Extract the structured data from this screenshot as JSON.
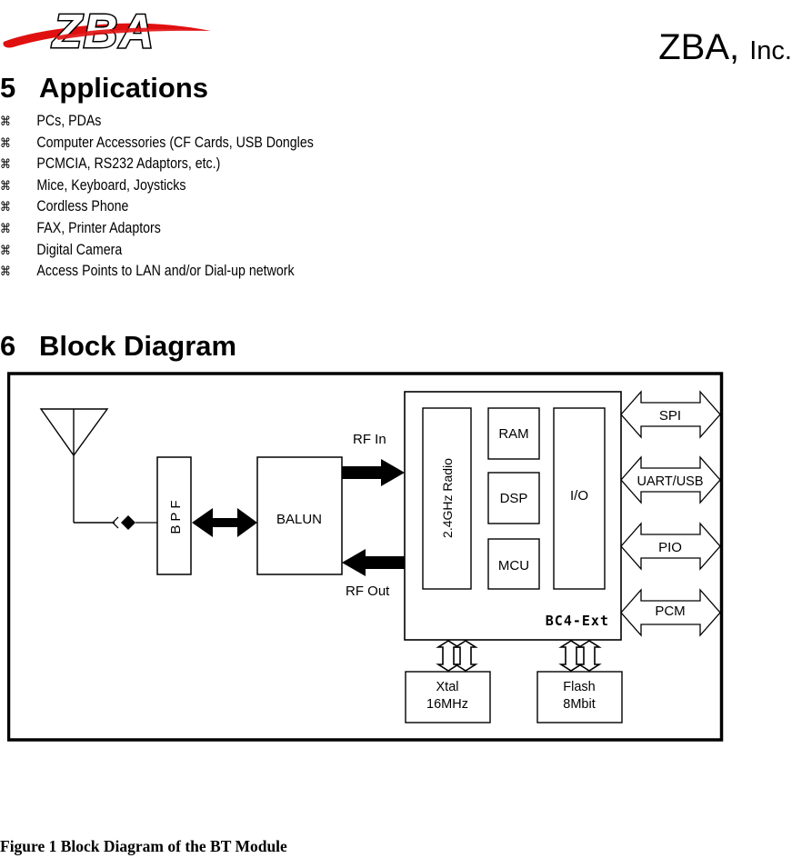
{
  "header": {
    "logo_text": "ZBA",
    "logo_colors": {
      "swoosh": "#e01010",
      "letter_fill": "#ffffff",
      "letter_outline": "#000000"
    },
    "company_name": "ZBA,",
    "company_suffix": "Inc."
  },
  "sections": {
    "applications": {
      "number": "5",
      "title": "Applications",
      "bullet_glyph": "⌘",
      "items": [
        "PCs, PDAs",
        "Computer Accessories (CF Cards, USB Dongles",
        "PCMCIA, RS232 Adaptors, etc.)",
        "Mice, Keyboard, Joysticks",
        "Cordless Phone",
        "FAX, Printer Adaptors",
        "Digital Camera",
        "Access Points to LAN and/or Dial-up network"
      ]
    },
    "block_diagram": {
      "number": "6",
      "title": "Block Diagram"
    }
  },
  "diagram": {
    "labels": {
      "bpf": "BPF",
      "balun": "BALUN",
      "rf_in": "RF In",
      "rf_out": "RF Out",
      "radio": "2.4GHz Radio",
      "ram": "RAM",
      "dsp": "DSP",
      "mcu": "MCU",
      "io": "I/O",
      "chip": "BC4-Ext",
      "spi": "SPI",
      "uart_usb": "UART/USB",
      "pio": "PIO",
      "pcm": "PCM",
      "xtal_line1": "Xtal",
      "xtal_line2": "16MHz",
      "flash_line1": "Flash",
      "flash_line2": "8Mbit"
    }
  },
  "caption": "Figure 1 Block Diagram of the BT Module"
}
